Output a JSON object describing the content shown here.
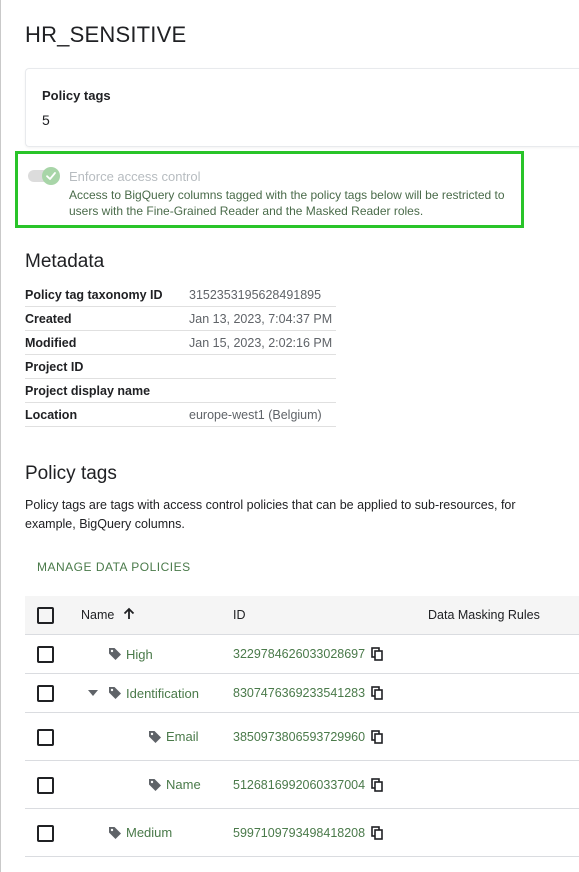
{
  "page": {
    "title": "HR_SENSITIVE"
  },
  "summary": {
    "label": "Policy tags",
    "value": "5"
  },
  "enforce": {
    "title": "Enforce access control",
    "description": "Access to BigQuery columns tagged with the policy tags below will be restricted to users with the Fine-Grained Reader and the Masked Reader roles.",
    "enabled": true,
    "highlight_color": "#29c429"
  },
  "metadata": {
    "heading": "Metadata",
    "rows": [
      {
        "key": "Policy tag taxonomy ID",
        "value": "3152353195628491895"
      },
      {
        "key": "Created",
        "value": "Jan 13, 2023, 7:04:37 PM"
      },
      {
        "key": "Modified",
        "value": "Jan 15, 2023, 2:02:16 PM"
      },
      {
        "key": "Project ID",
        "value": ""
      },
      {
        "key": "Project display name",
        "value": ""
      },
      {
        "key": "Location",
        "value": "europe-west1 (Belgium)"
      }
    ]
  },
  "policy_tags": {
    "heading": "Policy tags",
    "description": "Policy tags are tags with access control policies that can be applied to sub-resources, for example, BigQuery columns.",
    "manage_button": "MANAGE DATA POLICIES",
    "columns": {
      "name": "Name",
      "id": "ID",
      "masking": "Data Masking Rules"
    },
    "sort_icon": "arrow-up-icon",
    "rows": [
      {
        "name": "High",
        "id": "3229784626033028697",
        "level": 1,
        "expandable": false
      },
      {
        "name": "Identification",
        "id": "8307476369233541283",
        "level": 1,
        "expandable": true
      },
      {
        "name": "Email",
        "id": "3850973806593729960",
        "level": 2,
        "expandable": false
      },
      {
        "name": "Name",
        "id": "5126816992060337004",
        "level": 2,
        "expandable": false
      },
      {
        "name": "Medium",
        "id": "5997109793498418208",
        "level": 1,
        "expandable": false
      }
    ]
  },
  "colors": {
    "accent_green": "#4a7a4a",
    "text": "#202124",
    "muted": "#5f6368"
  }
}
